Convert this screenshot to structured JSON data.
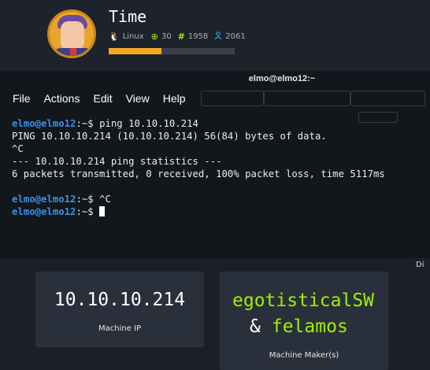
{
  "machine": {
    "name": "Time",
    "os": "Linux",
    "points": "30",
    "owns": "1958",
    "users": "2061",
    "progress_fraction": 0.42,
    "icons": {
      "os": "linux-penguin-icon",
      "points": "target-icon",
      "owns": "hash-icon",
      "users": "user-icon"
    }
  },
  "terminal": {
    "title": "elmo@elmo12:~",
    "menu": [
      "File",
      "Actions",
      "Edit",
      "View",
      "Help"
    ],
    "prompt_user": "elmo@elmo12",
    "prompt_suffix": ":~$ ",
    "lines": [
      {
        "type": "cmd",
        "text": "ping 10.10.10.214"
      },
      {
        "type": "out",
        "text": "PING 10.10.10.214 (10.10.10.214) 56(84) bytes of data."
      },
      {
        "type": "out",
        "text": "^C"
      },
      {
        "type": "out",
        "text": "--- 10.10.10.214 ping statistics ---"
      },
      {
        "type": "out",
        "text": "6 packets transmitted, 0 received, 100% packet loss, time 5117ms"
      },
      {
        "type": "out",
        "text": ""
      },
      {
        "type": "cmd",
        "text": "^C"
      },
      {
        "type": "cmd_cursor",
        "text": ""
      }
    ]
  },
  "cards": {
    "ip": {
      "value": "10.10.10.214",
      "label": "Machine IP"
    },
    "maker": {
      "name1": "egotisticalSW",
      "amp": "&",
      "name2": "felamos",
      "label": "Machine Maker(s)"
    }
  },
  "side_text": "Di",
  "colors": {
    "accent_green": "#9fef00",
    "prompt_blue": "#3c8fe8",
    "progress_orange": "#f5a623"
  }
}
